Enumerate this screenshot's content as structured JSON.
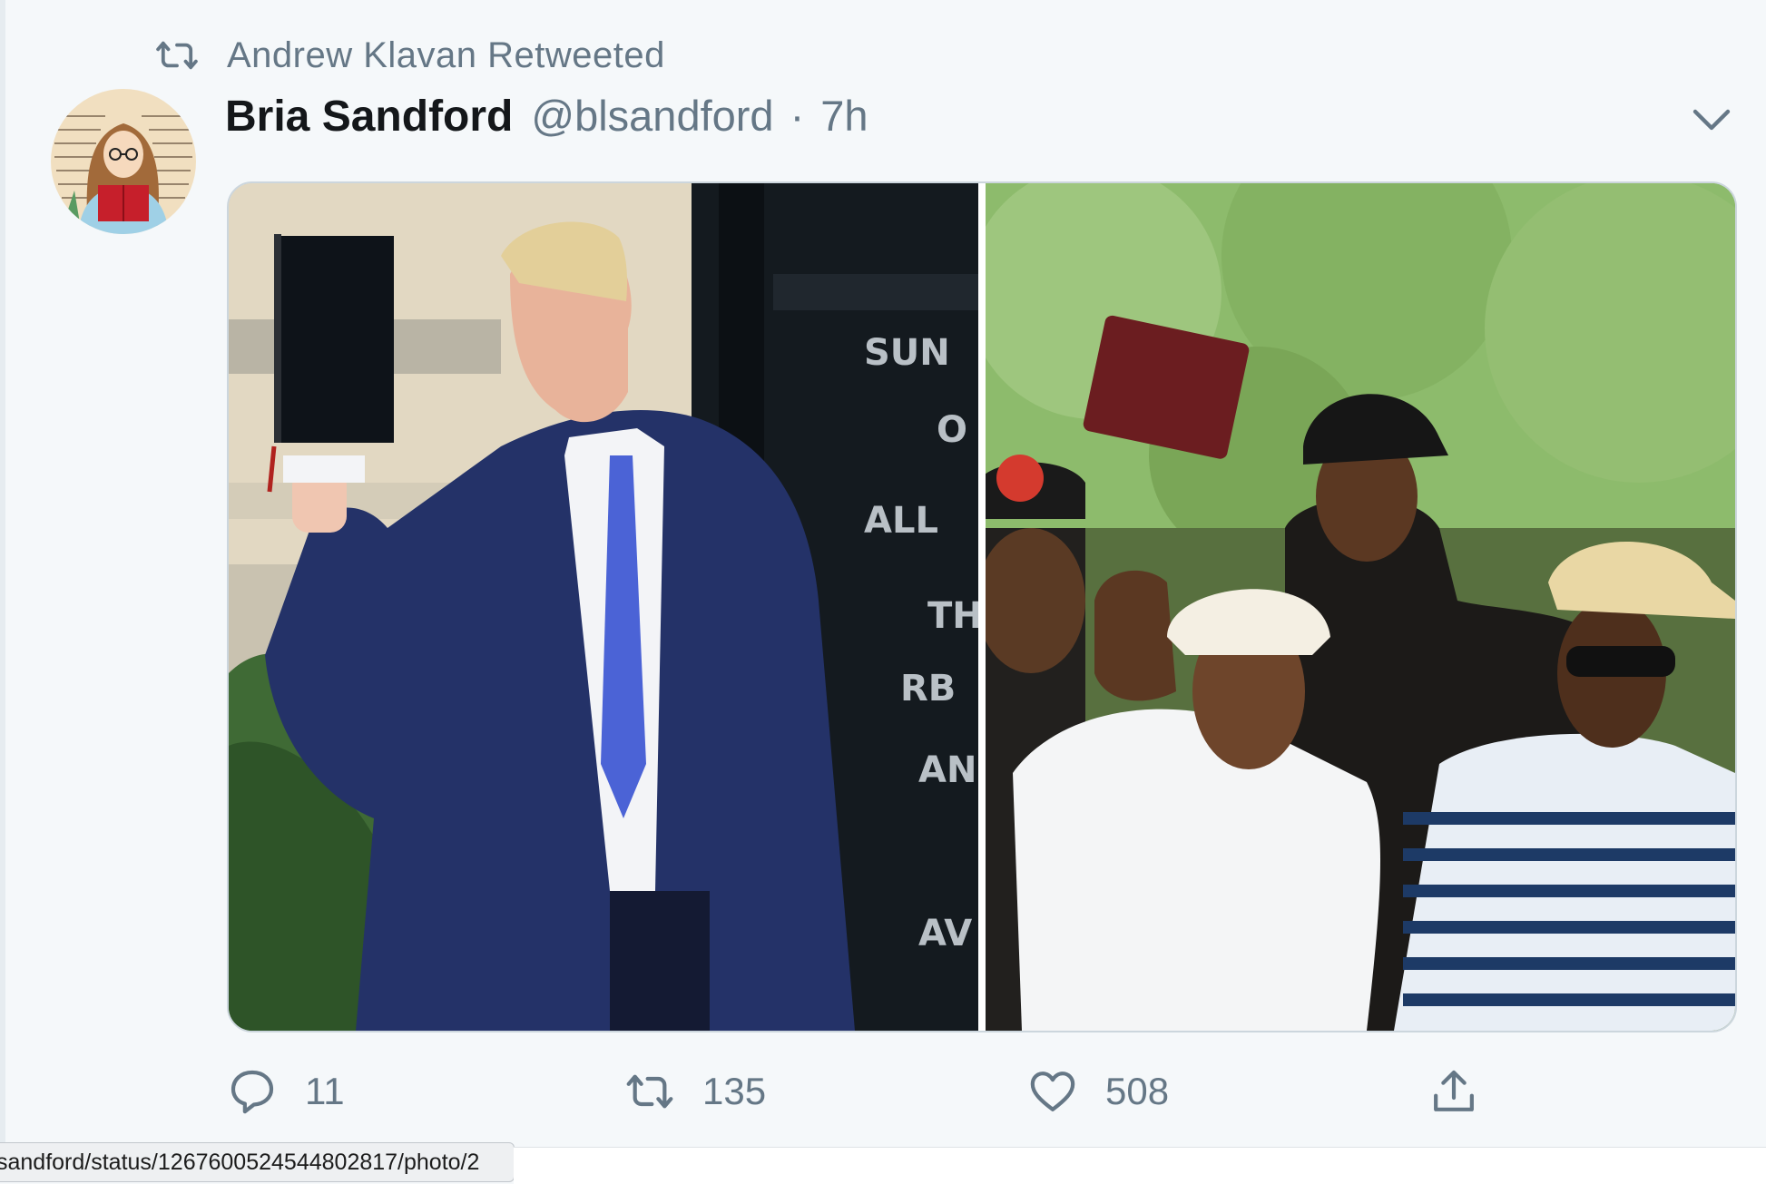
{
  "retweet": {
    "text": "Andrew Klavan Retweeted",
    "icon": "retweet-icon"
  },
  "tweet": {
    "author_name": "Bria Sandford",
    "handle": "@blsandford",
    "separator": "·",
    "time": "7h",
    "menu_icon": "chevron-down-icon"
  },
  "actions": {
    "reply_count": "11",
    "retweet_count": "135",
    "like_count": "508"
  },
  "status_bar": {
    "url": "sandford/status/1267600524544802817/photo/2"
  },
  "colors": {
    "background": "#f5f8fa",
    "muted": "#657786",
    "text": "#14171a",
    "border": "#ccd6dd"
  }
}
